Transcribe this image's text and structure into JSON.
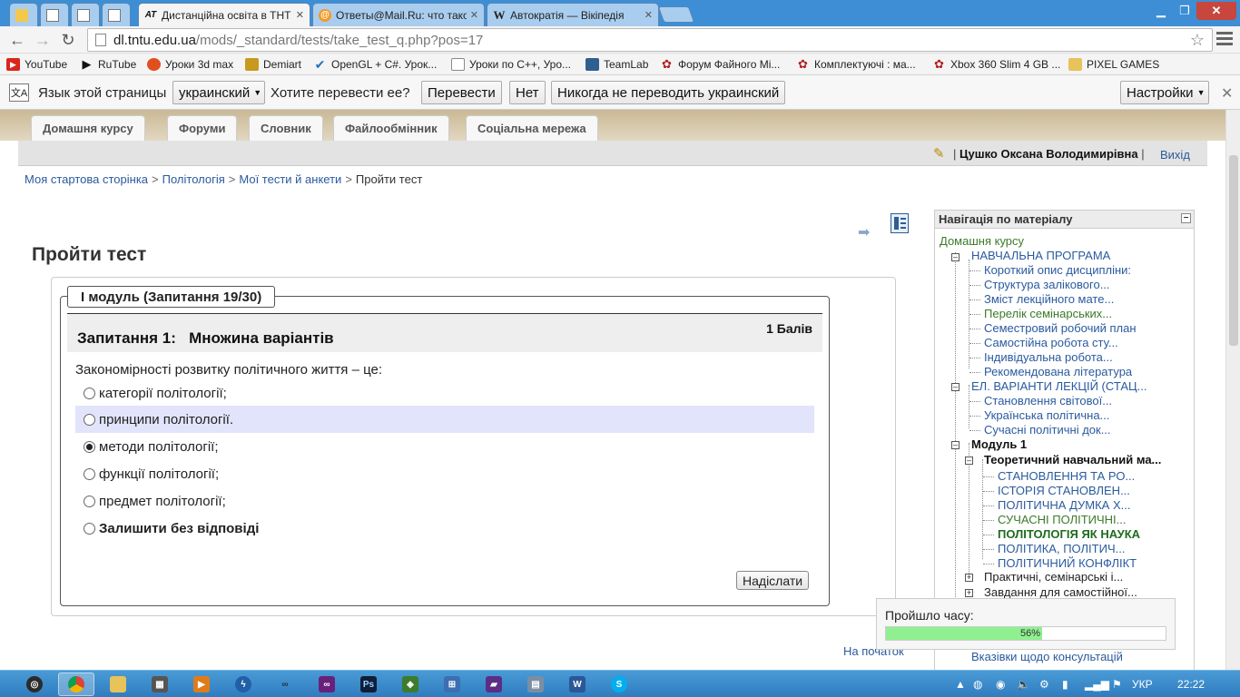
{
  "browser": {
    "tabs": [
      {
        "icon": "lock-icon",
        "label": ""
      },
      {
        "icon": "page-icon",
        "label": ""
      },
      {
        "icon": "page-icon",
        "label": ""
      },
      {
        "icon": "page-icon",
        "label": ""
      },
      {
        "icon": "at-icon",
        "label": "Дистанційна освіта в ТНТ"
      },
      {
        "icon": "mail-ru-icon",
        "label": "Ответы@Mail.Ru: что тако"
      },
      {
        "icon": "wikipedia-icon",
        "label": "Автократія — Вікіпедія"
      }
    ],
    "url_domain": "dl.tntu.edu.ua",
    "url_path": "/mods/_standard/tests/take_test_q.php?pos=17",
    "bookmarks": [
      "YouTube",
      "RuTube",
      "Уроки 3d max",
      "Demiart",
      "OpenGL + C#. Урок...",
      "Уроки по C++, Уро...",
      "TeamLab",
      "Форум Файного Мі...",
      "Комплектуючі : ма...",
      "Xbox 360 Slim 4 GB ...",
      "PIXEL GAMES"
    ]
  },
  "translate_bar": {
    "prompt": "Язык этой страницы",
    "language": "украинский",
    "question": "Хотите перевести ее?",
    "translate": "Перевести",
    "no": "Нет",
    "never": "Никогда не переводить украинский",
    "settings": "Настройки"
  },
  "course_nav": [
    "Домашня курсу",
    "Форуми",
    "Словник",
    "Файлообмінник",
    "Соціальна мережа"
  ],
  "user": {
    "name": "Цушко Оксана Володимирівна",
    "separator": "|",
    "logout": "Вихід"
  },
  "breadcrumbs": [
    "Моя стартова сторінка",
    "Політологія",
    "Мої тести й анкети",
    "Пройти тест"
  ],
  "page_title": "Пройти тест",
  "test": {
    "module_legend": "I модуль (Запитання 19/30)",
    "question_number": "Запитання 1:",
    "question_type": "Множина варіантів",
    "points": "1 Балів",
    "question_text": "Закономірності розвитку політичного життя – це:",
    "options": [
      {
        "label": "категорії політології;",
        "selected": false
      },
      {
        "label": "принципи політології.",
        "selected": false
      },
      {
        "label": "методи політології;",
        "selected": true
      },
      {
        "label": "функції політології;",
        "selected": false
      },
      {
        "label": "предмет політології;",
        "selected": false
      },
      {
        "label": "Залишити без відповіді",
        "selected": false
      }
    ],
    "submit": "Надіслати",
    "top_link": "На початок"
  },
  "sidebar": {
    "title": "Навігація по матеріалу",
    "home": "Домашня курсу",
    "items": [
      "НАВЧАЛЬНА ПРОГРАМА",
      "Короткий опис дисципліни:",
      "Структура залікового...",
      "Зміст лекційного мате...",
      "Перелік семінарських...",
      "Семестровий робочий план",
      "Самостійна робота сту...",
      "Індивідуальна робота...",
      "Рекомендована література",
      "ЕЛ. ВАРІАНТИ ЛЕКЦІЙ (СТАЦ...",
      "Становлення світової...",
      "Українська політична...",
      "Сучасні політичні док...",
      "Модуль 1",
      "Теоретичний навчальний ма...",
      "СТАНОВЛЕННЯ ТА РО...",
      "ІСТОРІЯ СТАНОВЛЕН...",
      "ПОЛІТИЧНА ДУМКА Х...",
      "СУЧАСНІ ПОЛІТИЧНІ...",
      "ПОЛІТОЛОГІЯ ЯК НАУКА",
      "ПОЛІТИКА, ПОЛІТИЧ...",
      "ПОЛІТИЧНИЙ КОНФЛІКТ",
      "Практичні, семінарські і...",
      "Завдання для самостійної...",
      "Вказівки щодо консультацій"
    ]
  },
  "timer": {
    "label": "Пройшло часу:",
    "percent_text": "56%",
    "fraction": 0.56
  },
  "taskbar": {
    "language": "УКР",
    "time": "22:22"
  }
}
